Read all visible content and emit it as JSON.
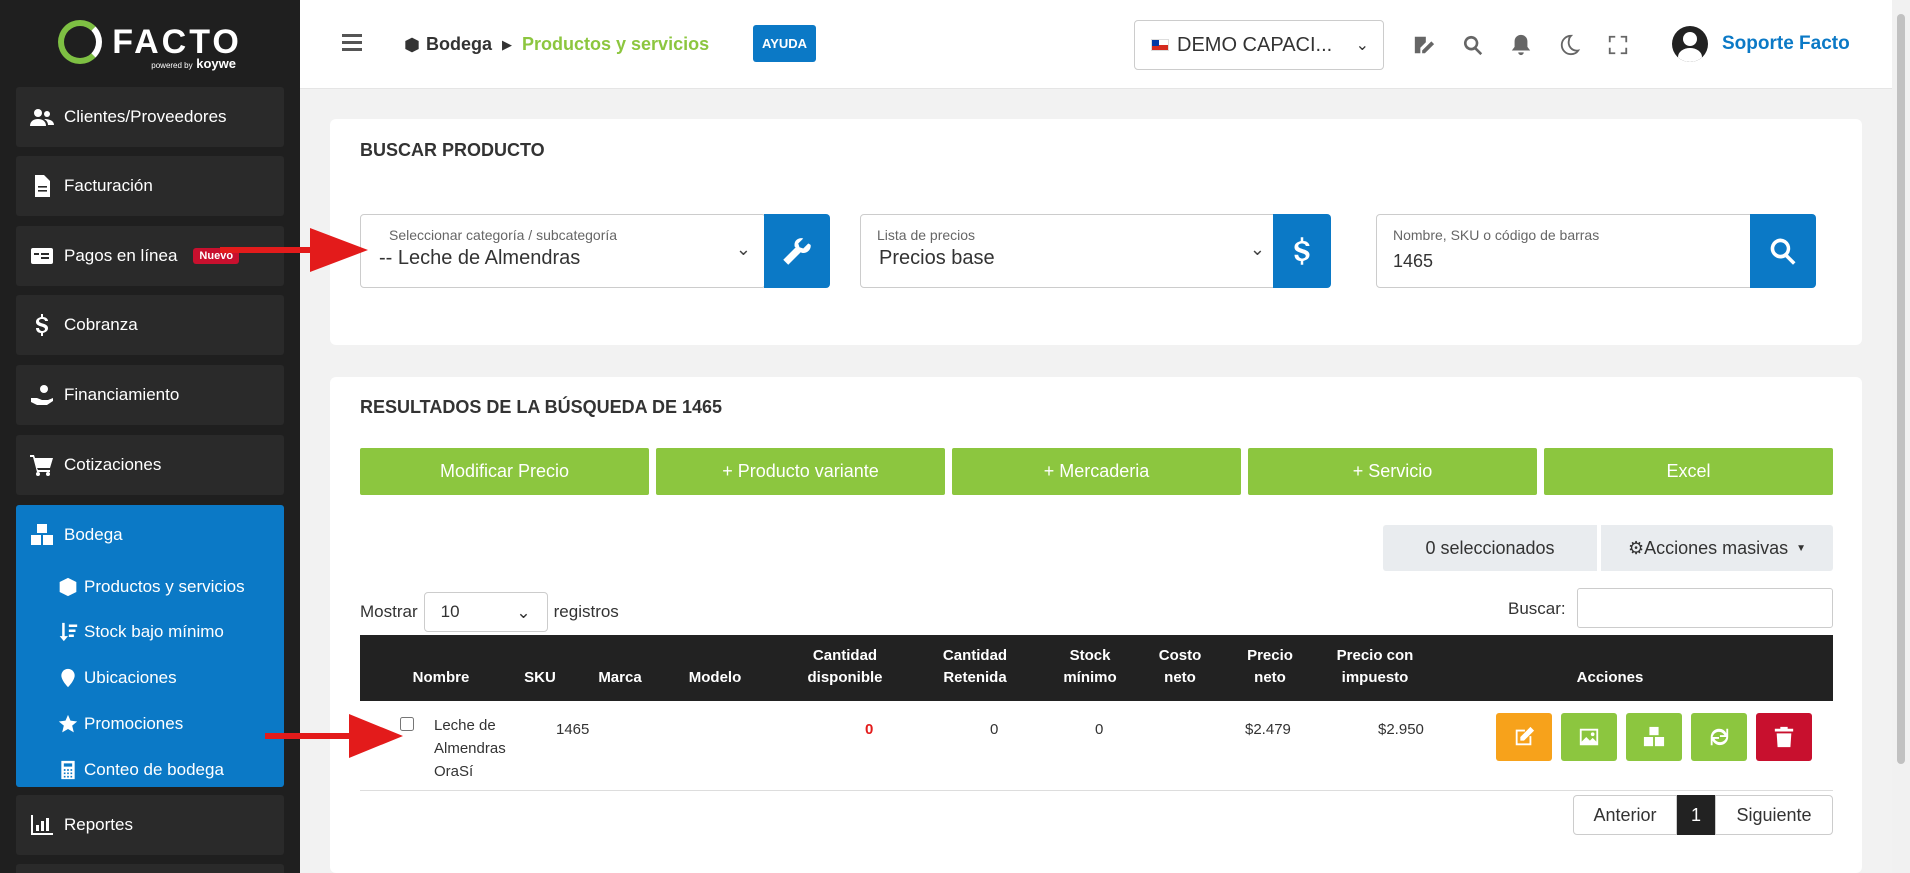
{
  "sidebar": {
    "brand": "FACTO",
    "brand_sub_small": "powered by",
    "brand_sub": "koywe",
    "items": [
      {
        "label": "Clientes/Proveedores",
        "icon": "users-icon"
      },
      {
        "label": "Facturación",
        "icon": "file-icon"
      },
      {
        "label": "Pagos en línea",
        "icon": "card-icon",
        "badge": "Nuevo"
      },
      {
        "label": "Cobranza",
        "icon": "dollar-icon"
      },
      {
        "label": "Financiamiento",
        "icon": "hand-money-icon"
      },
      {
        "label": "Cotizaciones",
        "icon": "cart-icon"
      }
    ],
    "active": {
      "label": "Bodega",
      "icon": "boxes-icon",
      "subs": [
        {
          "label": "Productos y servicios",
          "icon": "cube-icon"
        },
        {
          "label": "Stock bajo mínimo",
          "icon": "sort-down-icon"
        },
        {
          "label": "Ubicaciones",
          "icon": "pin-icon"
        },
        {
          "label": "Promociones",
          "icon": "star-icon"
        },
        {
          "label": "Conteo de bodega",
          "icon": "calculator-icon"
        }
      ]
    },
    "reportes": "Reportes"
  },
  "topbar": {
    "crumb_root": "Bodega",
    "crumb_current": "Productos y servicios",
    "help": "AYUDA",
    "company": "DEMO CAPACI...",
    "user": "Soporte Facto"
  },
  "search": {
    "title": "BUSCAR PRODUCTO",
    "category_label": "Seleccionar categoría / subcategoría",
    "category_value": "-- Leche de Almendras",
    "pricelist_label": "Lista de precios",
    "pricelist_value": "Precios base",
    "query_label": "Nombre, SKU o código de barras",
    "query_value": "1465"
  },
  "results": {
    "title": "RESULTADOS DE LA BÚSQUEDA DE 1465",
    "buttons": [
      "Modificar Precio",
      "+ Producto variante",
      "+ Mercaderia",
      "+ Servicio",
      "Excel"
    ],
    "selected": "0 seleccionados",
    "mass_actions": "Acciones masivas",
    "show_label": "Mostrar",
    "show_value": "10",
    "records_label": "registros",
    "search_label": "Buscar:",
    "columns": [
      "Nombre",
      "SKU",
      "Marca",
      "Modelo",
      "Cantidad disponible",
      "Cantidad Retenida",
      "Stock mínimo",
      "Costo neto",
      "Precio neto",
      "Precio con impuesto",
      "Acciones"
    ],
    "row": {
      "name": "Leche de Almendras OraSí",
      "sku": "1465",
      "brand": "",
      "model": "",
      "available": "0",
      "retained": "0",
      "min_stock": "0",
      "net_cost": "",
      "net_price": "$2.479",
      "tax_price": "$2.950"
    },
    "pager": {
      "prev": "Anterior",
      "page": "1",
      "next": "Siguiente"
    }
  },
  "colors": {
    "accent_blue": "#0b79c6",
    "accent_green": "#8cc63f",
    "danger": "#c8102e",
    "warning": "#f7a21b",
    "arrow": "#e31b1b"
  }
}
